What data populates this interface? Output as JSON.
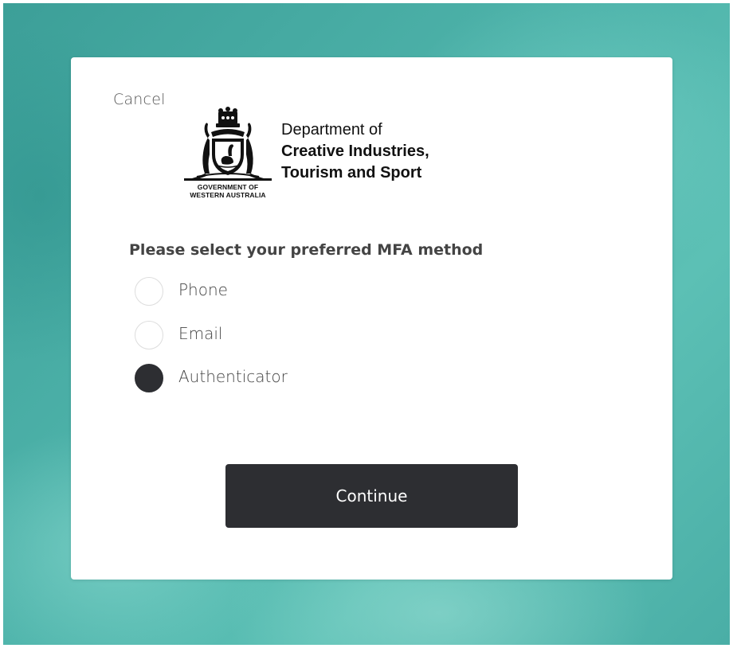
{
  "header": {
    "cancel_label": "Cancel"
  },
  "logo": {
    "gov_line1": "GOVERNMENT OF",
    "gov_line2": "WESTERN AUSTRALIA",
    "dept_line1": "Department of",
    "dept_line2": "Creative Industries,",
    "dept_line3": "Tourism and Sport"
  },
  "mfa": {
    "prompt": "Please select your preferred MFA method",
    "options": [
      {
        "label": "Phone",
        "selected": false
      },
      {
        "label": "Email",
        "selected": false
      },
      {
        "label": "Authenticator",
        "selected": true
      }
    ]
  },
  "actions": {
    "continue_label": "Continue"
  },
  "colors": {
    "accent": "#2d2e32",
    "background": "#4fb4ab"
  }
}
